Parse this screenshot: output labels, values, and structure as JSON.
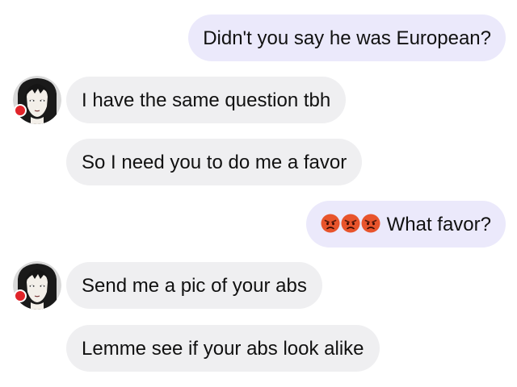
{
  "conversation": {
    "messages": [
      {
        "direction": "outgoing",
        "text": "Didn't you say he was European?"
      },
      {
        "direction": "incoming",
        "text": "I have the same question tbh"
      },
      {
        "direction": "incoming",
        "text": "So I need you to do me a favor"
      },
      {
        "direction": "outgoing",
        "emoji": [
          "pouting-face",
          "pouting-face",
          "pouting-face"
        ],
        "text": "What favor?"
      },
      {
        "direction": "incoming",
        "text": "Send me a pic of your abs"
      },
      {
        "direction": "incoming",
        "text": "Lemme see if your abs look alike"
      }
    ]
  },
  "colors": {
    "outgoing_bubble": "#ebe9fb",
    "incoming_bubble": "#efeff1",
    "online_dot": "#e0242a",
    "emoji_face": "#e8542c"
  },
  "avatar": {
    "icon": "anime-girl-avatar",
    "status": "online"
  }
}
